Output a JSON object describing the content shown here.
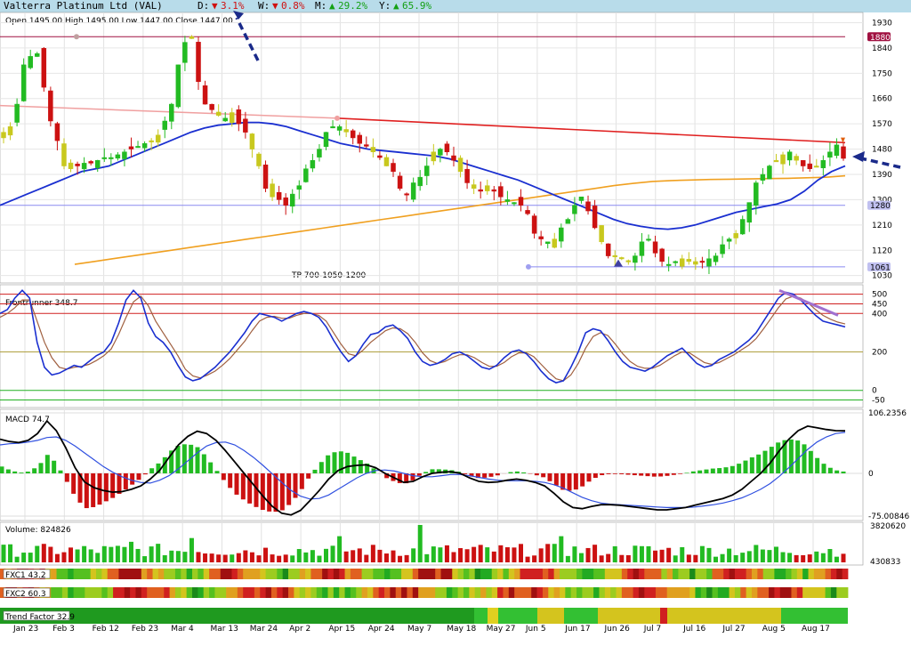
{
  "header": {
    "title": "Valterra Platinum Ltd (VAL)",
    "day": {
      "label": "D:",
      "arrow": "▼",
      "value": "3.1%"
    },
    "week": {
      "label": "W:",
      "arrow": "▼",
      "value": "0.8%"
    },
    "month": {
      "label": "M:",
      "arrow": "▲",
      "value": "29.2%"
    },
    "year": {
      "label": "Y:",
      "arrow": "▲",
      "value": "65.9%"
    }
  },
  "colors": {
    "up": "#22bb22",
    "down": "#cc1111",
    "neutral": "#c8c81e",
    "ma_short": "#1a2fd0",
    "ma_long": "#f0a020",
    "trendline": "#e02020",
    "level": "#a01040",
    "dn_pct": "#d01010",
    "up_pct": "#14a014"
  },
  "chart_data": [
    {
      "type": "candlestick",
      "title": "",
      "ohlc_text": "Open 1495.00  High 1495.00  Low 1447.00  Close 1447.00",
      "y_ticks": [
        1930,
        1840,
        1750,
        1660,
        1570,
        1480,
        1390,
        1300,
        1210,
        1120,
        1030
      ],
      "ylim": [
        1010,
        1960
      ],
      "x_ticks": [
        "Jan 23",
        "Feb 3",
        "Feb 12",
        "Feb 23",
        "Mar 4",
        "Mar 13",
        "Mar 24",
        "Apr 2",
        "Apr 15",
        "Apr 24",
        "May 7",
        "May 18",
        "May 27",
        "Jun 5",
        "Jun 17",
        "Jun 26",
        "Jul 7",
        "Jul 16",
        "Jul 27",
        "Aug 5",
        "Aug 17"
      ],
      "levels": [
        {
          "value": 1880,
          "label": "1880"
        },
        {
          "value": 1280,
          "label": "1280"
        },
        {
          "value": 1061,
          "label": "1061"
        }
      ],
      "annotation": "TP 700-1050-1200",
      "close_series": [
        1540,
        1560,
        1640,
        1780,
        1810,
        1820,
        1700,
        1580,
        1510,
        1420,
        1410,
        1420,
        1430,
        1430,
        1440,
        1450,
        1450,
        1460,
        1470,
        1480,
        1490,
        1500,
        1510,
        1530,
        1580,
        1640,
        1780,
        1860,
        1880,
        1720,
        1640,
        1620,
        1600,
        1590,
        1610,
        1570,
        1540,
        1480,
        1420,
        1340,
        1310,
        1300,
        1280,
        1320,
        1350,
        1410,
        1440,
        1480,
        1540,
        1560,
        1560,
        1550,
        1520,
        1500,
        1490,
        1470,
        1450,
        1420,
        1400,
        1340,
        1320,
        1360,
        1380,
        1420,
        1470,
        1480,
        1470,
        1440,
        1400,
        1360,
        1340,
        1330,
        1350,
        1330,
        1310,
        1300,
        1290,
        1280,
        1250,
        1180,
        1160,
        1150,
        1160,
        1200,
        1230,
        1280,
        1310,
        1260,
        1200,
        1150,
        1100,
        1100,
        1090,
        1080,
        1100,
        1150,
        1160,
        1110,
        1080,
        1070,
        1080,
        1090,
        1080,
        1070,
        1080,
        1090,
        1100,
        1140,
        1160,
        1180,
        1230,
        1290,
        1360,
        1390,
        1420,
        1440,
        1460,
        1470,
        1440,
        1420,
        1410,
        1420,
        1440,
        1470,
        1495,
        1447
      ],
      "ma_short": [
        1280,
        1300,
        1320,
        1340,
        1360,
        1380,
        1400,
        1410,
        1420,
        1440,
        1460,
        1480,
        1500,
        1520,
        1540,
        1555,
        1565,
        1570,
        1575,
        1575,
        1570,
        1560,
        1545,
        1530,
        1515,
        1500,
        1490,
        1480,
        1475,
        1470,
        1465,
        1460,
        1455,
        1445,
        1430,
        1415,
        1400,
        1385,
        1370,
        1350,
        1330,
        1310,
        1290,
        1270,
        1250,
        1230,
        1215,
        1205,
        1198,
        1195,
        1200,
        1210,
        1225,
        1240,
        1255,
        1265,
        1275,
        1285,
        1300,
        1330,
        1370,
        1400,
        1420
      ],
      "ma_long": [
        1070,
        1080,
        1090,
        1100,
        1110,
        1120,
        1130,
        1140,
        1150,
        1160,
        1170,
        1180,
        1190,
        1200,
        1210,
        1220,
        1230,
        1240,
        1250,
        1260,
        1270,
        1280,
        1290,
        1300,
        1310,
        1320,
        1330,
        1340,
        1350,
        1358,
        1365,
        1368,
        1370,
        1372,
        1373,
        1374,
        1375,
        1376,
        1378,
        1380,
        1385
      ],
      "trendline": [
        1620,
        1500
      ],
      "volume_label": "Volume: 824826",
      "volume_max_label": "3820620",
      "volume_min_label": "430833"
    },
    {
      "type": "line",
      "title": "",
      "label": "Frontrunner 348.7",
      "y_ticks": [
        500,
        450,
        400,
        200,
        0,
        -50
      ],
      "ylim": [
        -80,
        540
      ],
      "series": [
        {
          "values": [
            400,
            420,
            480,
            520,
            480,
            250,
            120,
            80,
            90,
            110,
            130,
            120,
            150,
            180,
            200,
            250,
            350,
            470,
            520,
            480,
            350,
            280,
            250,
            200,
            130,
            70,
            50,
            60,
            90,
            120,
            160,
            200,
            250,
            300,
            360,
            400,
            390,
            380,
            360,
            380,
            400,
            410,
            400,
            380,
            330,
            260,
            200,
            150,
            180,
            240,
            290,
            300,
            330,
            340,
            310,
            270,
            200,
            150,
            130,
            140,
            160,
            190,
            200,
            180,
            150,
            120,
            110,
            130,
            170,
            200,
            210,
            190,
            150,
            100,
            60,
            40,
            50,
            120,
            200,
            300,
            320,
            310,
            260,
            200,
            150,
            120,
            110,
            100,
            120,
            150,
            180,
            200,
            220,
            180,
            140,
            120,
            130,
            160,
            180,
            200,
            230,
            260,
            300,
            360,
            420,
            480,
            510,
            500,
            470,
            430,
            390,
            360,
            350,
            340,
            330
          ]
        },
        {
          "values": [
            380,
            400,
            430,
            470,
            470,
            360,
            250,
            170,
            120,
            110,
            120,
            125,
            135,
            155,
            180,
            215,
            290,
            380,
            460,
            490,
            440,
            360,
            300,
            240,
            180,
            110,
            75,
            65,
            80,
            100,
            130,
            165,
            210,
            255,
            310,
            360,
            380,
            385,
            375,
            375,
            390,
            400,
            400,
            390,
            360,
            300,
            240,
            190,
            180,
            210,
            250,
            280,
            310,
            325,
            320,
            295,
            250,
            195,
            155,
            140,
            150,
            170,
            185,
            185,
            170,
            145,
            125,
            125,
            145,
            175,
            195,
            195,
            175,
            135,
            95,
            60,
            50,
            80,
            140,
            220,
            280,
            300,
            285,
            240,
            190,
            150,
            125,
            115,
            115,
            130,
            155,
            180,
            200,
            195,
            170,
            145,
            135,
            145,
            165,
            185,
            210,
            235,
            270,
            320,
            375,
            430,
            475,
            490,
            480,
            455,
            420,
            390,
            370,
            355,
            345
          ]
        }
      ]
    },
    {
      "type": "line",
      "title": "",
      "label": "MACD 74.7",
      "y_ticks": [
        106.2356,
        0,
        -75.00846
      ],
      "ylim": [
        -75.00846,
        106.2356
      ],
      "series": [
        {
          "values": [
            60,
            56,
            54,
            58,
            70,
            92,
            75,
            45,
            10,
            -15,
            -25,
            -30,
            -33,
            -32,
            -28,
            -22,
            -10,
            5,
            28,
            50,
            65,
            74,
            70,
            58,
            40,
            20,
            0,
            -20,
            -40,
            -58,
            -70,
            -73,
            -65,
            -48,
            -30,
            -10,
            5,
            12,
            14,
            15,
            10,
            0,
            -8,
            -16,
            -14,
            -6,
            0,
            2,
            3,
            0,
            -8,
            -14,
            -16,
            -15,
            -12,
            -10,
            -12,
            -16,
            -22,
            -35,
            -50,
            -60,
            -62,
            -58,
            -55,
            -55,
            -56,
            -58,
            -60,
            -62,
            -64,
            -64,
            -62,
            -60,
            -56,
            -52,
            -48,
            -44,
            -38,
            -28,
            -14,
            0,
            18,
            40,
            60,
            75,
            83,
            80,
            77,
            75,
            74.7
          ]
        },
        {
          "values": [
            50,
            52,
            53,
            55,
            58,
            63,
            64,
            58,
            48,
            36,
            24,
            12,
            2,
            -6,
            -12,
            -16,
            -17,
            -12,
            -4,
            8,
            22,
            36,
            48,
            54,
            55,
            50,
            40,
            28,
            14,
            -1,
            -16,
            -30,
            -40,
            -45,
            -44,
            -38,
            -28,
            -18,
            -8,
            0,
            5,
            6,
            4,
            0,
            -4,
            -6,
            -6,
            -4,
            -2,
            -2,
            -4,
            -7,
            -10,
            -12,
            -13,
            -13,
            -13,
            -14,
            -16,
            -20,
            -26,
            -34,
            -42,
            -48,
            -52,
            -54,
            -55,
            -56,
            -57,
            -58,
            -59,
            -60,
            -60,
            -60,
            -59,
            -57,
            -55,
            -52,
            -48,
            -43,
            -36,
            -28,
            -18,
            -5,
            10,
            26,
            42,
            55,
            64,
            70,
            72
          ]
        }
      ]
    },
    {
      "type": "heatmap",
      "rows": [
        {
          "label": "FXC1 43.2"
        },
        {
          "label": "FXC2 60.3"
        },
        {
          "label": "Trend Factor 32.9"
        }
      ]
    }
  ]
}
